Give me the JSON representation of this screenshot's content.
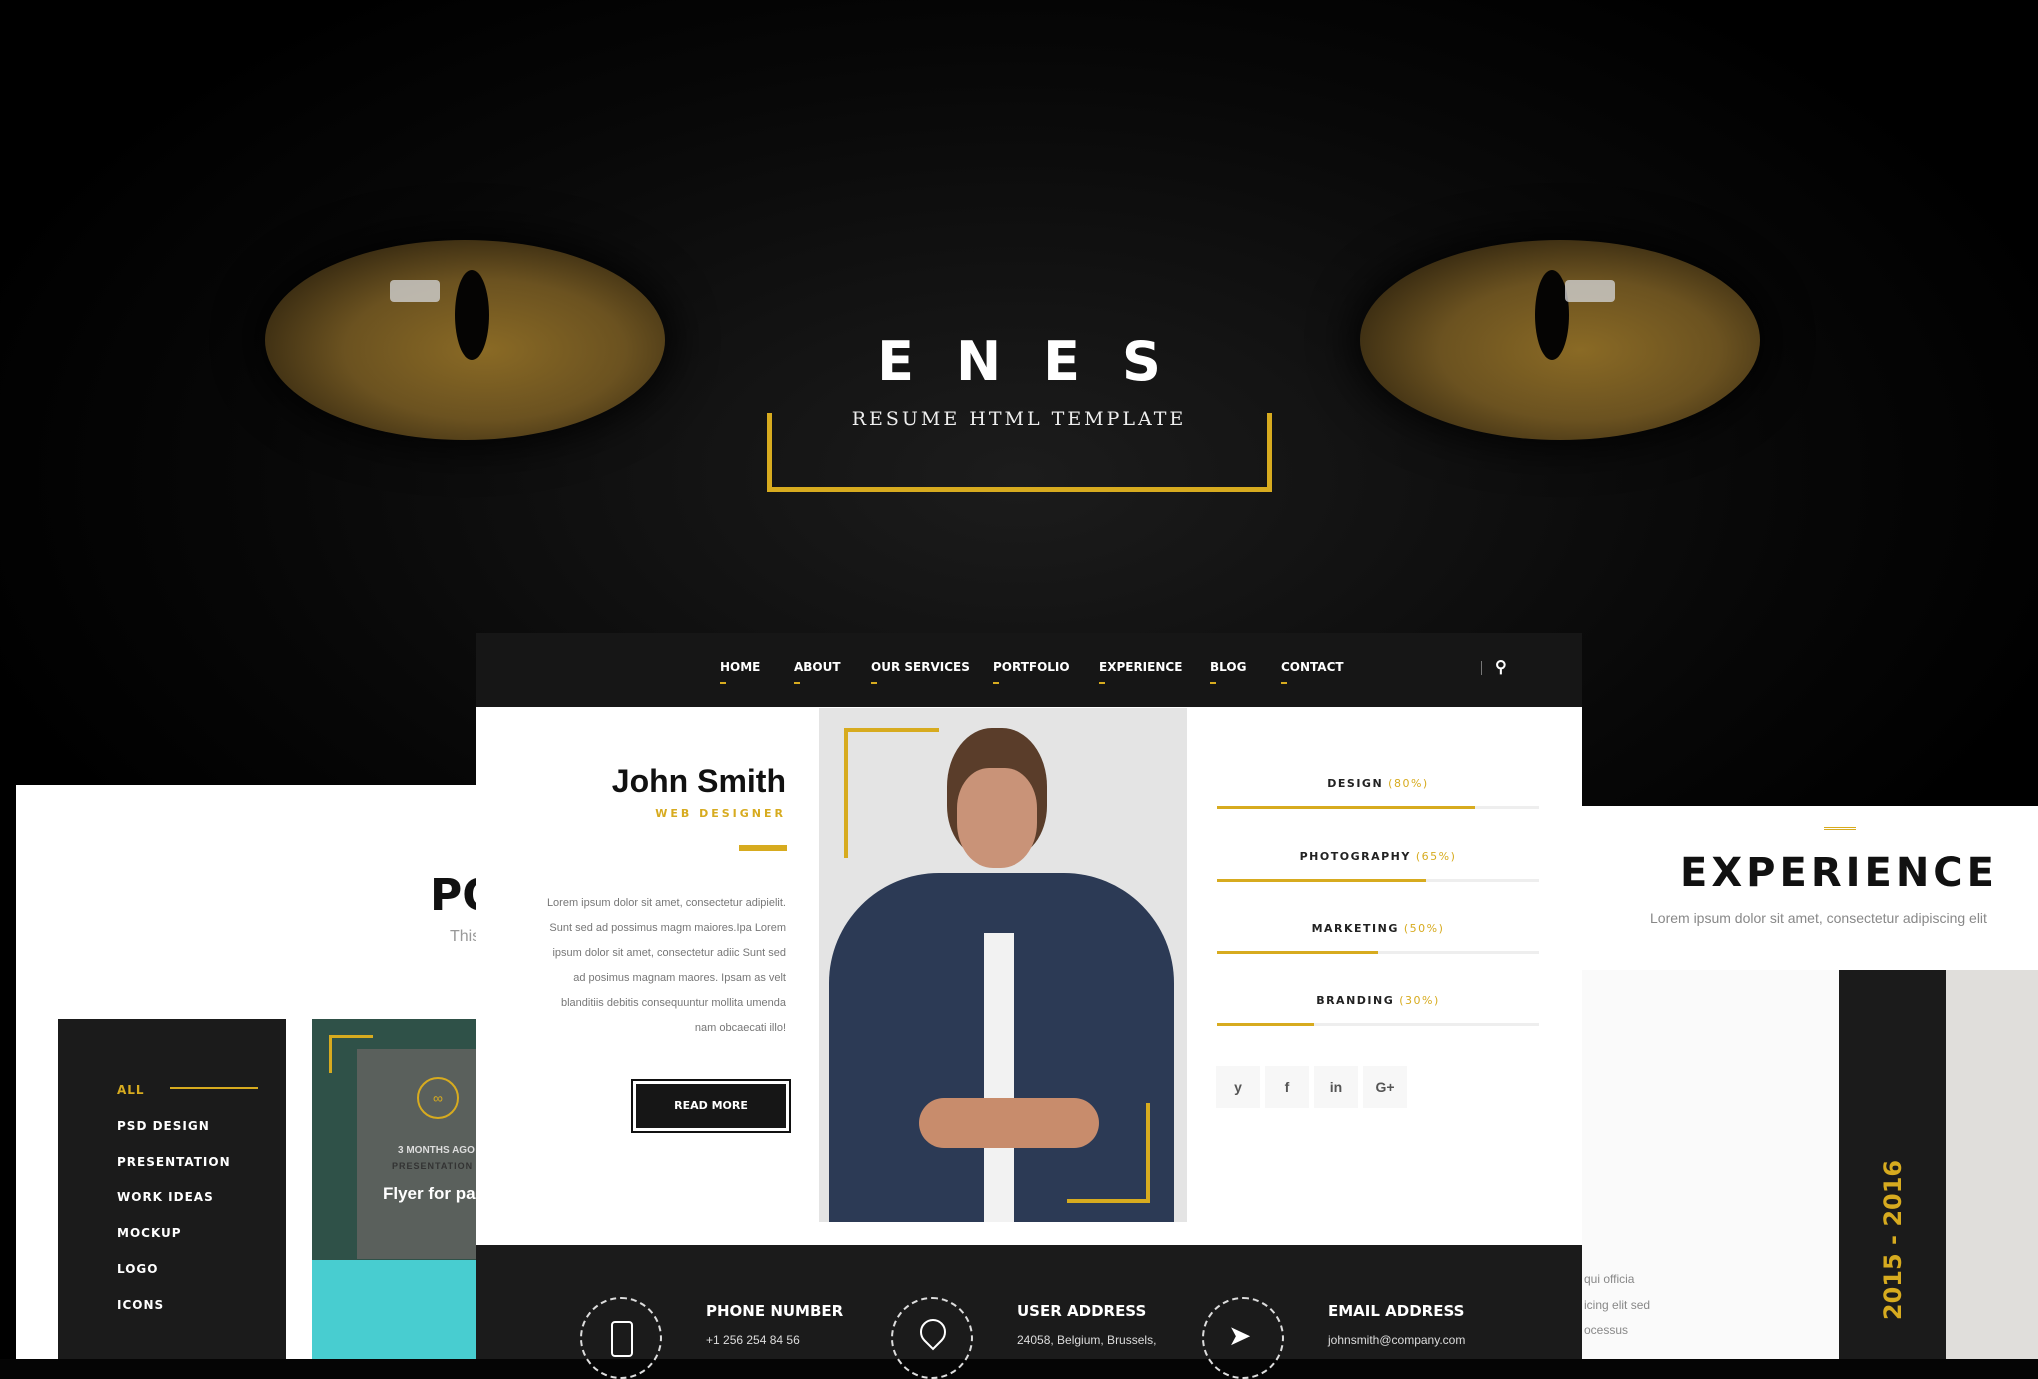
{
  "hero": {
    "brand": "ENES",
    "tagline": "RESUME HTML TEMPLATE"
  },
  "colors": {
    "accent": "#d7ab1f",
    "dark": "#1b1b1b"
  },
  "nav": {
    "items": [
      "HOME",
      "ABOUT",
      "OUR SERVICES",
      "PORTFOLIO",
      "EXPERIENCE",
      "BLOG",
      "CONTACT"
    ],
    "search_icon": "search-icon"
  },
  "profile": {
    "name": "John Smith",
    "role": "WEB DESIGNER",
    "bio": [
      "Lorem ipsum dolor sit amet, consectetur adipielit.",
      "Sunt sed ad possimus magm maiores.Ipa Lorem",
      "ipsum dolor sit amet, consectetur adiic Sunt sed",
      "ad posimus magnam maores. Ipsam as velt",
      "blanditiis debitis consequuntur mollita umenda",
      "nam obcaecati illo!"
    ],
    "read_more": "READ MORE"
  },
  "skills": [
    {
      "label": "DESIGN",
      "pct": "(80%)",
      "value": 80
    },
    {
      "label": "PHOTOGRAPHY",
      "pct": "(65%)",
      "value": 65
    },
    {
      "label": "MARKETING",
      "pct": "(50%)",
      "value": 50
    },
    {
      "label": "BRANDING",
      "pct": "(30%)",
      "value": 30
    }
  ],
  "social": [
    "twitter-icon",
    "facebook-icon",
    "linkedin-icon",
    "google-plus-icon"
  ],
  "social_glyphs": [
    "y",
    "f",
    "in",
    "G+"
  ],
  "contact": [
    {
      "title": "PHONE NUMBER",
      "value": "+1 256 254 84 56"
    },
    {
      "title": "USER ADDRESS",
      "value": "24058, Belgium, Brussels,"
    },
    {
      "title": "EMAIL ADDRESS",
      "value": "johnsmith@company.com"
    }
  ],
  "portfolio": {
    "title": "PO",
    "subtitle": "This",
    "filters": [
      "ALL",
      "PSD DESIGN",
      "PRESENTATION",
      "WORK IDEAS",
      "MOCKUP",
      "LOGO",
      "ICONS"
    ],
    "card": {
      "time": "3 MONTHS AGO",
      "category": "PRESENTATION",
      "title": "Flyer for par"
    }
  },
  "experience": {
    "title": "EXPERIENCE",
    "subtitle": "Lorem ipsum dolor sit amet, consectetur adipiscing elit",
    "years": "2015 - 2016",
    "text": [
      "qui officia",
      "icing elit sed",
      "ocessus"
    ]
  }
}
